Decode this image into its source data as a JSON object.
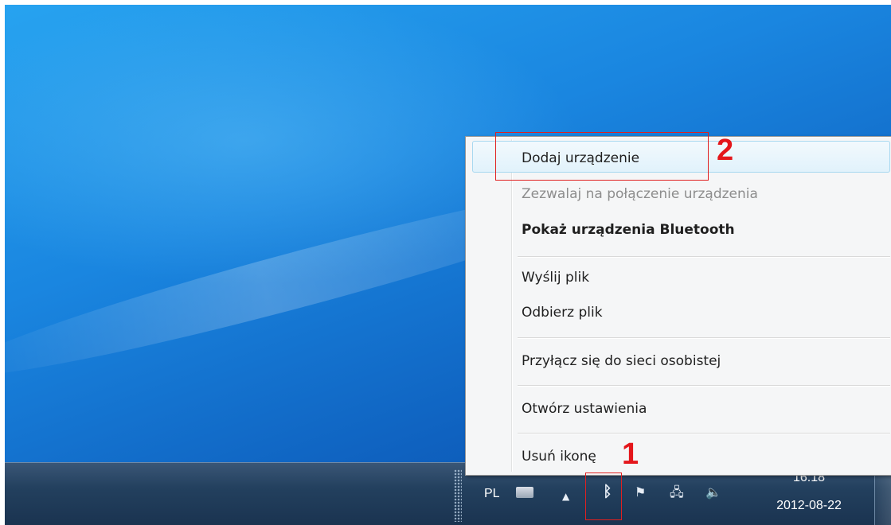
{
  "context_menu": {
    "items": [
      {
        "label": "Dodaj urządzenie",
        "state": "highlighted"
      },
      {
        "label": "Zezwalaj na połączenie urządzenia",
        "state": "disabled"
      },
      {
        "label": "Pokaż urządzenia Bluetooth",
        "state": "default-bold"
      },
      {
        "label": "Wyślij plik",
        "state": "normal"
      },
      {
        "label": "Odbierz plik",
        "state": "normal"
      },
      {
        "label": "Przyłącz się do sieci osobistej",
        "state": "normal"
      },
      {
        "label": "Otwórz ustawienia",
        "state": "normal"
      },
      {
        "label": "Usuń ikonę",
        "state": "normal"
      }
    ]
  },
  "annotations": {
    "step1": "1",
    "step2": "2",
    "color": "#e4161b"
  },
  "taskbar": {
    "language": "PL",
    "tray_icons": [
      "keyboard-icon",
      "show-hidden-icons-arrow",
      "bluetooth-icon",
      "action-center-flag-icon",
      "network-icon",
      "volume-icon"
    ],
    "clock": {
      "time": "16:18",
      "date": "2012-08-22"
    }
  },
  "colors": {
    "desktop_blue": "#1a86e0",
    "menu_background": "#f5f6f7",
    "highlight_border": "#a8d8f0"
  }
}
